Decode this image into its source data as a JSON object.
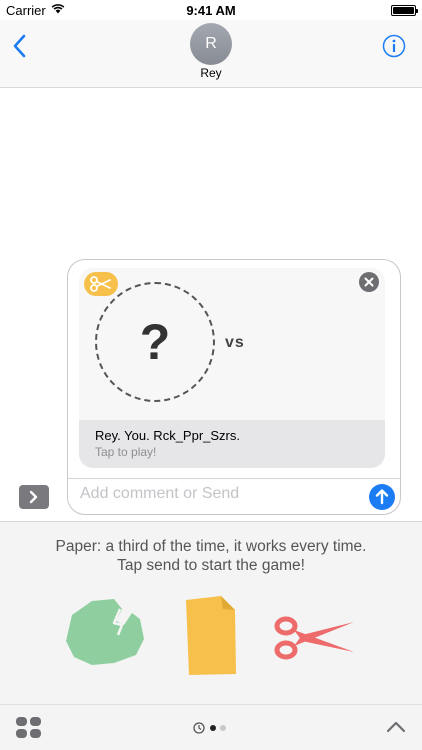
{
  "status_bar": {
    "carrier": "Carrier",
    "time": "9:41 AM",
    "wifi_icon": "wifi-icon",
    "battery_icon": "battery-icon"
  },
  "nav": {
    "back_icon": "chevron-left-icon",
    "avatar_initial": "R",
    "contact_name": "Rey",
    "info_icon": "info-icon"
  },
  "message": {
    "badge_icon": "scissors-icon",
    "close_icon": "close-icon",
    "question_mark": "?",
    "vs_label": "vs",
    "caption_title": "Rey. You. Rck_Ppr_Szrs.",
    "caption_subtitle": "Tap to play!"
  },
  "composer": {
    "expand_icon": "chevron-right-icon",
    "placeholder": "Add comment or Send",
    "value": "",
    "send_icon": "arrow-up-icon"
  },
  "panel": {
    "tagline_line1": "Paper: a third of the time, it works every time.",
    "tagline_line2": "Tap send to start the game!",
    "stickers": [
      {
        "name": "rock",
        "icon": "rock-icon",
        "color": "#8fcf9f"
      },
      {
        "name": "paper",
        "icon": "paper-icon",
        "color": "#f7c04a"
      },
      {
        "name": "scissors",
        "icon": "scissors-icon",
        "color": "#ee6b6b"
      }
    ]
  },
  "bottom_bar": {
    "apps_icon": "app-grid-icon",
    "recents_icon": "clock-icon",
    "page_count": 3,
    "current_page": 2,
    "collapse_icon": "chevron-up-icon"
  },
  "colors": {
    "accent": "#1b7cf3",
    "badge_yellow": "#f7c04a",
    "rock_green": "#8fcf9f",
    "scissors_red": "#ee6b6b"
  }
}
